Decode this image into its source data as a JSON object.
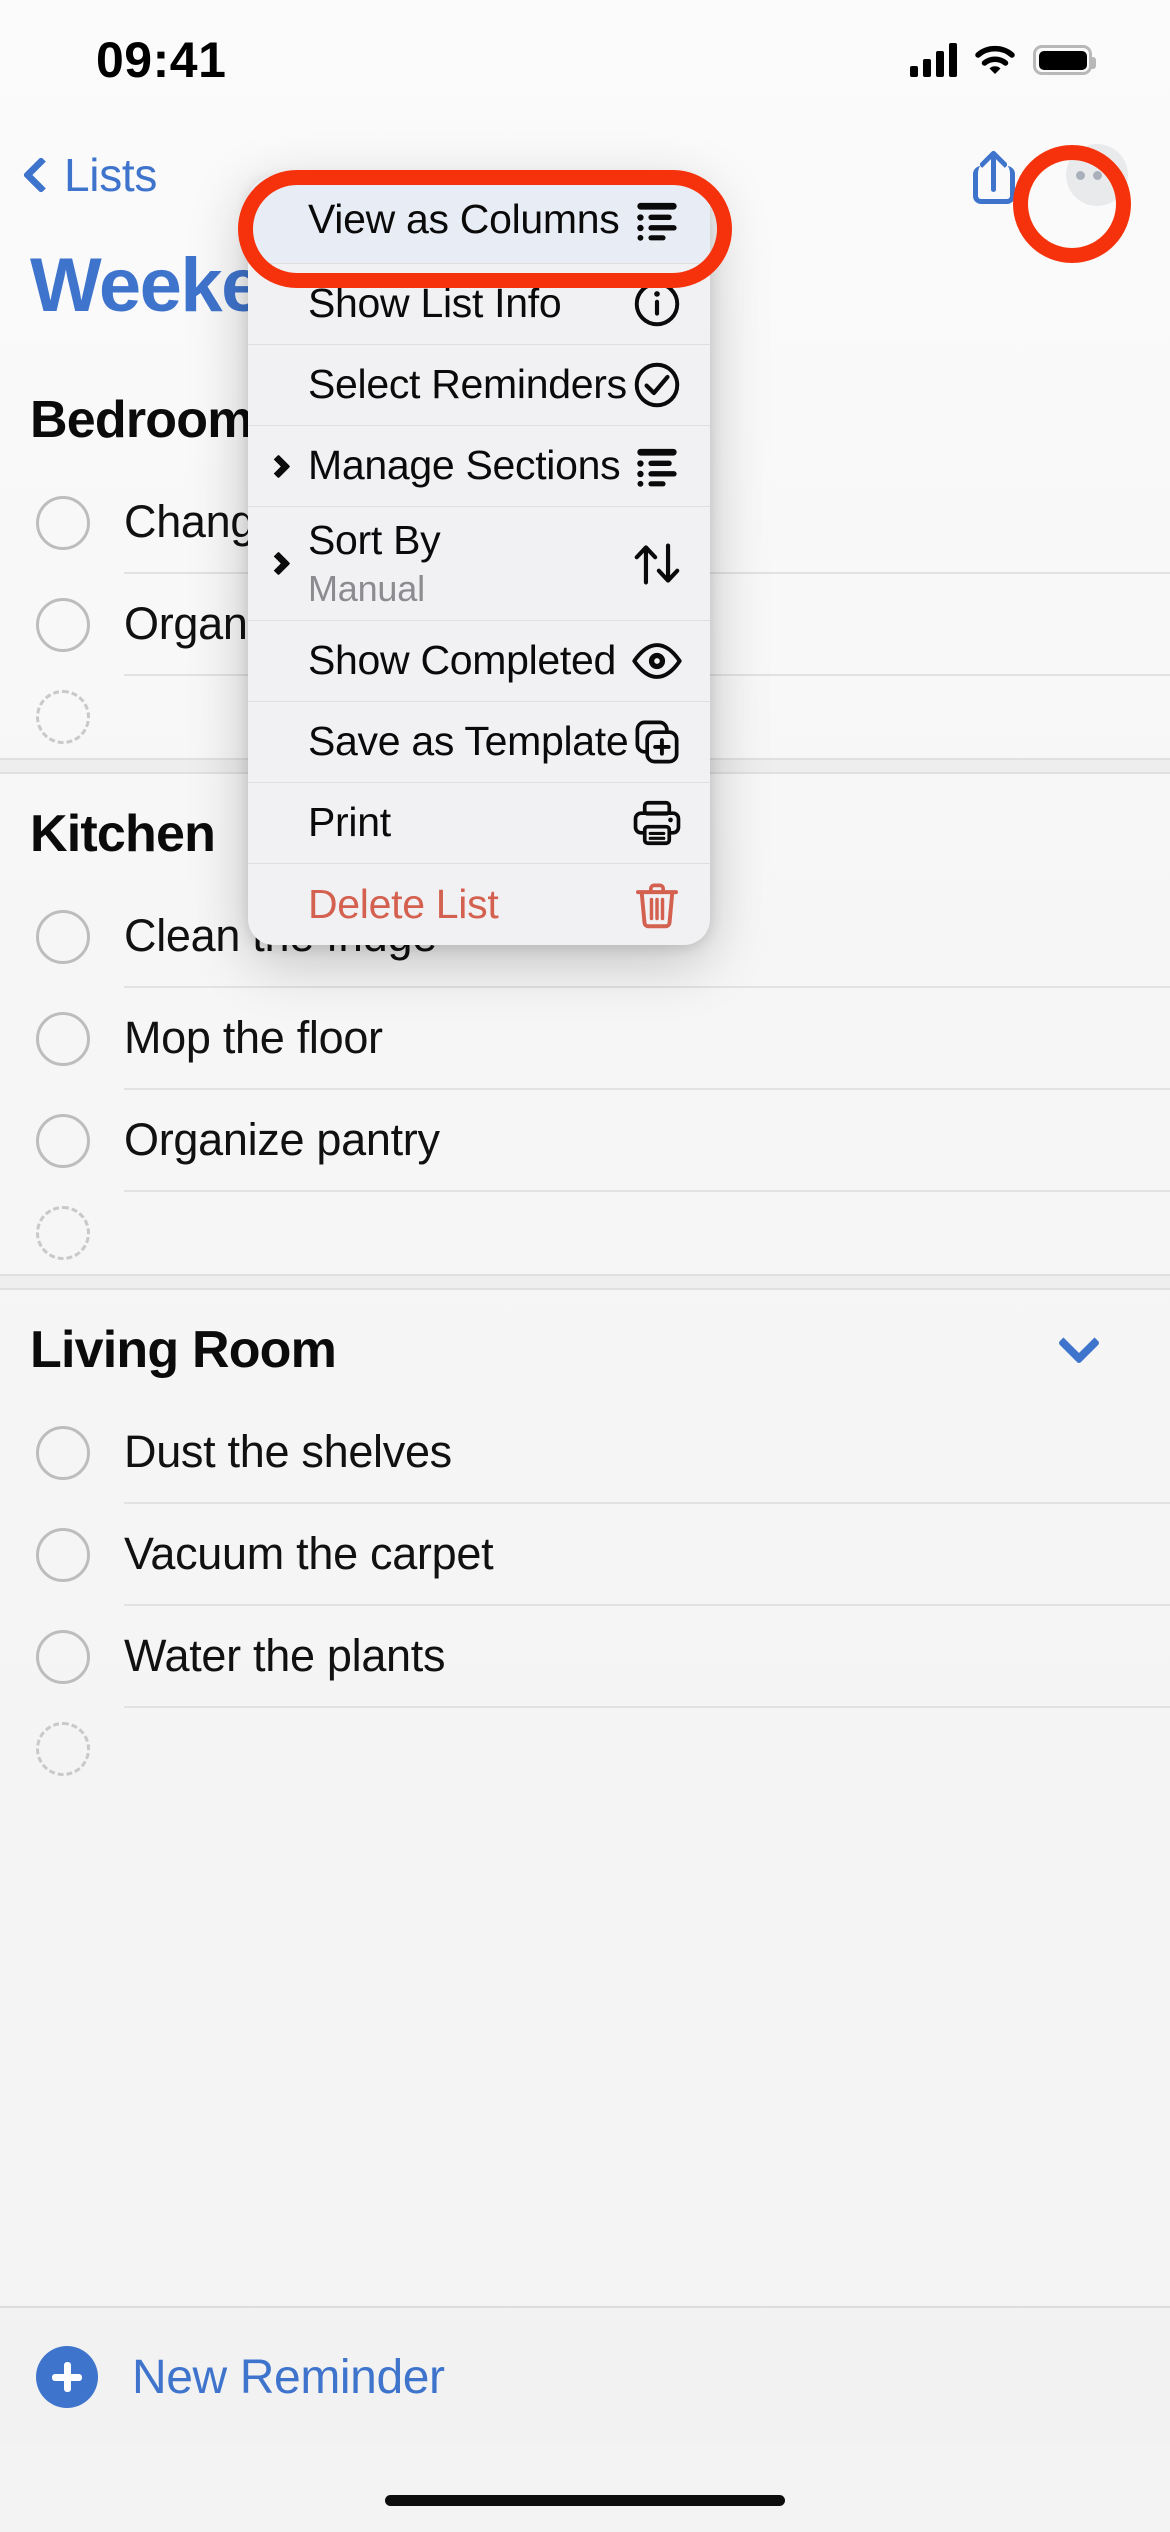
{
  "status_bar": {
    "time": "09:41",
    "cellular_icon": "cellular-signal-icon",
    "wifi_icon": "wifi-icon",
    "battery_icon": "battery-icon"
  },
  "nav_bar": {
    "back_label": "Lists",
    "back_icon": "chevron-left-icon",
    "share_icon": "share-icon",
    "more_icon": "ellipsis-circle-icon"
  },
  "page": {
    "title": "Weekend Chores",
    "title_accent_color": "#3f74cd"
  },
  "sections": [
    {
      "name": "Bedroom",
      "collapse_icon": null,
      "reminders": [
        {
          "text": "Change bed sheets",
          "completed": false
        },
        {
          "text": "Organize the closet",
          "completed": false
        }
      ],
      "has_new_placeholder": true
    },
    {
      "name": "Kitchen",
      "collapse_icon": null,
      "reminders": [
        {
          "text": "Clean the fridge",
          "completed": false
        },
        {
          "text": "Mop the floor",
          "completed": false
        },
        {
          "text": "Organize pantry",
          "completed": false
        }
      ],
      "has_new_placeholder": true
    },
    {
      "name": "Living Room",
      "collapse_icon": "chevron-down-icon",
      "reminders": [
        {
          "text": "Dust the shelves",
          "completed": false
        },
        {
          "text": "Vacuum the carpet",
          "completed": false
        },
        {
          "text": "Water the plants",
          "completed": false
        }
      ],
      "has_new_placeholder": true
    }
  ],
  "bottom_bar": {
    "new_reminder_label": "New Reminder",
    "add_icon": "plus-circle-icon"
  },
  "context_menu": {
    "items": [
      {
        "label": "View as Columns",
        "sublabel": null,
        "icon": "list-bullet-indent-icon",
        "has_submenu": false,
        "highlighted": true,
        "destructive": false
      },
      {
        "label": "Show List Info",
        "sublabel": null,
        "icon": "info-circle-icon",
        "has_submenu": false,
        "highlighted": false,
        "destructive": false
      },
      {
        "label": "Select Reminders",
        "sublabel": null,
        "icon": "checkmark-circle-icon",
        "has_submenu": false,
        "highlighted": false,
        "destructive": false
      },
      {
        "label": "Manage Sections",
        "sublabel": null,
        "icon": "list-bullet-indent-icon",
        "has_submenu": true,
        "highlighted": false,
        "destructive": false
      },
      {
        "label": "Sort By",
        "sublabel": "Manual",
        "icon": "arrow-up-arrow-down-icon",
        "has_submenu": true,
        "highlighted": false,
        "destructive": false
      },
      {
        "label": "Show Completed",
        "sublabel": null,
        "icon": "eye-icon",
        "has_submenu": false,
        "highlighted": false,
        "destructive": false
      },
      {
        "label": "Save as Template",
        "sublabel": null,
        "icon": "duplicate-plus-icon",
        "has_submenu": false,
        "highlighted": false,
        "destructive": false
      },
      {
        "label": "Print",
        "sublabel": null,
        "icon": "printer-icon",
        "has_submenu": false,
        "highlighted": false,
        "destructive": false
      },
      {
        "label": "Delete List",
        "sublabel": null,
        "icon": "trash-icon",
        "has_submenu": false,
        "highlighted": false,
        "destructive": true
      }
    ]
  },
  "annotations": {
    "highlight_color": "#f5320c",
    "rings": [
      {
        "target": "more-button"
      },
      {
        "target": "view-as-columns-menu-item"
      }
    ]
  }
}
